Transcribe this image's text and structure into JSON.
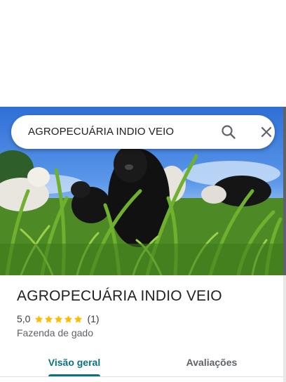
{
  "search": {
    "query": "AGROPECUÁRIA INDIO VEIO",
    "search_icon": "search-icon",
    "close_icon": "close-icon"
  },
  "hero": {
    "photo": "cattle-in-tall-grass-photo"
  },
  "place": {
    "title": "AGROPECUÁRIA INDIO VEIO",
    "rating": "5,0",
    "stars": 5,
    "review_count": "(1)",
    "category": "Fazenda de gado"
  },
  "tabs": [
    {
      "label": "Visão geral",
      "active": true
    },
    {
      "label": "Avaliações",
      "active": false
    }
  ],
  "colors": {
    "accent": "#0b7285",
    "star": "#fbbc04",
    "text": "#202124"
  }
}
